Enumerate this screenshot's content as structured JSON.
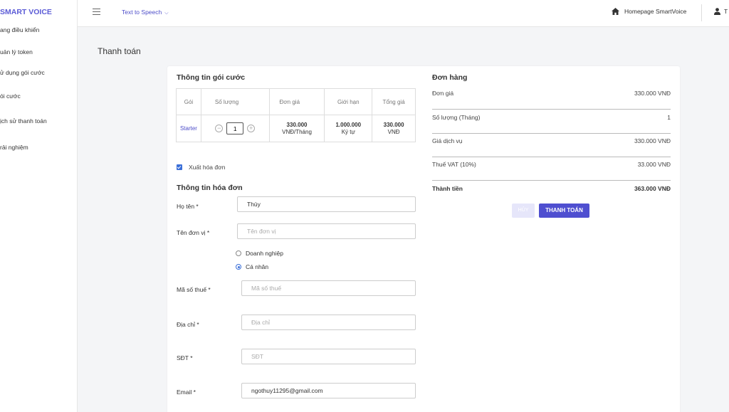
{
  "sidebar": {
    "brand": "SMART VOICE",
    "items": [
      {
        "label": "ang điều khiển"
      },
      {
        "label": "uản lý token"
      },
      {
        "label": "ử dụng gói cước"
      },
      {
        "label": "ói cước"
      },
      {
        "label": "ịch sử thanh toán"
      },
      {
        "label": "rải nghiệm"
      }
    ]
  },
  "topbar": {
    "menu_label": "Text to Speech",
    "homepage_label": "Homepage SmartVoice",
    "user_label": "T"
  },
  "page": {
    "title": "Thanh toán"
  },
  "package_info": {
    "title": "Thông tin gói cước",
    "headers": [
      "Gói",
      "Số lượng",
      "Đơn giá",
      "Giới hạn",
      "Tổng giá"
    ],
    "row": {
      "package": "Starter",
      "quantity": "1",
      "unit_price": "330.000",
      "unit_price_unit": "VNĐ/Tháng",
      "limit": "1.000.000",
      "limit_unit": "Ký tự",
      "total": "330.000",
      "total_unit": "VNĐ"
    }
  },
  "invoice": {
    "checkbox_label": "Xuất hóa đơn",
    "checkbox_checked": true,
    "title": "Thông tin hóa đơn",
    "name_label": "Họ tên *",
    "name_value": "Thùy",
    "org_label": "Tên đơn vị *",
    "org_placeholder": "Tên đơn vị",
    "type_options": [
      "Doanh nghiệp",
      "Cá nhân"
    ],
    "type_selected": "Cá nhân",
    "tax_label": "Mã số thuế *",
    "tax_placeholder": "Mã số thuế",
    "address_label": "Địa chỉ *",
    "address_placeholder": "Địa chỉ",
    "phone_label": "SĐT *",
    "phone_placeholder": "SĐT",
    "email_label": "Email *",
    "email_value": "ngothuy11295@gmail.com"
  },
  "order": {
    "title": "Đơn hàng",
    "rows": [
      {
        "label": "Đơn giá",
        "value": "330.000 VNĐ"
      },
      {
        "label": "Số lượng (Tháng)",
        "value": "1"
      },
      {
        "label": "Giá dịch vụ",
        "value": "330.000 VNĐ"
      },
      {
        "label": "Thuế VAT (10%)",
        "value": "33.000 VNĐ"
      }
    ],
    "total_label": "Thành tiền",
    "total_value": "363.000 VNĐ",
    "cancel_label": "HỦY",
    "pay_label": "THANH TOÁN"
  },
  "colors": {
    "accent": "#4f4fd0",
    "brand": "#5b5bd6",
    "link": "#4d4dc9",
    "checkbox": "#3b6fd8"
  }
}
